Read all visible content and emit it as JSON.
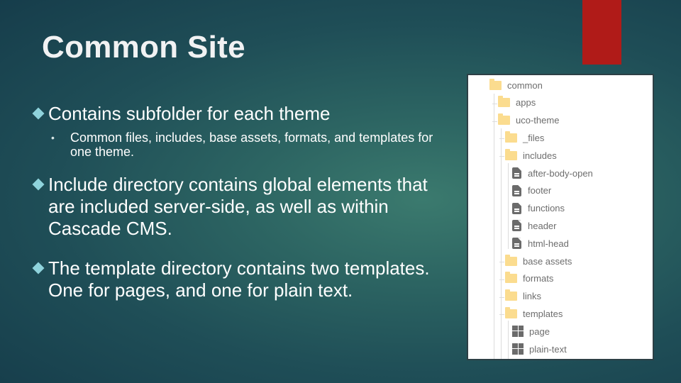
{
  "slide": {
    "title": "Common Site",
    "accent_color": "#b01b18",
    "bullets": [
      {
        "text": "Contains subfolder for each theme",
        "sub": [
          "Common files, includes, base assets, formats, and templates for one theme."
        ]
      },
      {
        "text": "Include directory contains global elements that are included server-side, as well as within Cascade CMS."
      },
      {
        "text": "The template directory contains two templates. One for pages, and one for plain text."
      }
    ]
  },
  "tree": {
    "items": [
      {
        "label": "common",
        "icon": "folder-icon",
        "depth": 0
      },
      {
        "label": "apps",
        "icon": "folder-icon",
        "depth": 1
      },
      {
        "label": "uco-theme",
        "icon": "folder-icon",
        "depth": 1
      },
      {
        "label": "_files",
        "icon": "folder-icon",
        "depth": 2
      },
      {
        "label": "includes",
        "icon": "folder-icon",
        "depth": 2
      },
      {
        "label": "after-body-open",
        "icon": "file-icon",
        "depth": 3
      },
      {
        "label": "footer",
        "icon": "file-icon",
        "depth": 3
      },
      {
        "label": "functions",
        "icon": "file-icon",
        "depth": 3
      },
      {
        "label": "header",
        "icon": "file-icon",
        "depth": 3
      },
      {
        "label": "html-head",
        "icon": "file-icon",
        "depth": 3
      },
      {
        "label": "base assets",
        "icon": "folder-icon",
        "depth": 2
      },
      {
        "label": "formats",
        "icon": "folder-icon",
        "depth": 2
      },
      {
        "label": "links",
        "icon": "folder-icon",
        "depth": 2
      },
      {
        "label": "templates",
        "icon": "folder-icon",
        "depth": 2
      },
      {
        "label": "page",
        "icon": "template-icon",
        "depth": 3
      },
      {
        "label": "plain-text",
        "icon": "template-icon",
        "depth": 3
      }
    ]
  }
}
